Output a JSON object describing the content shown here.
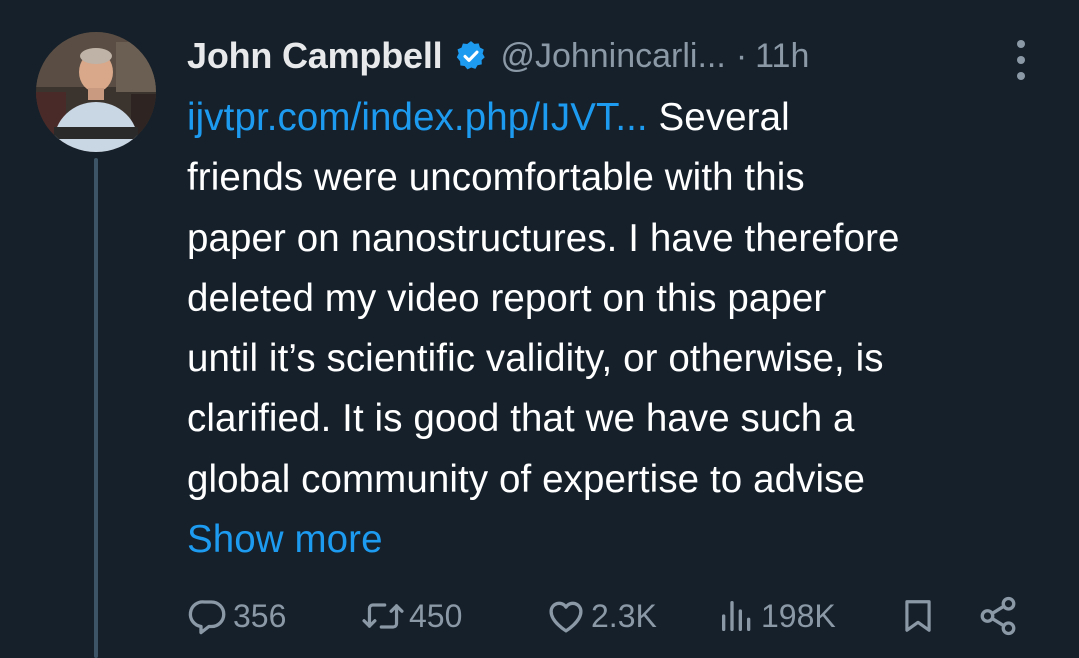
{
  "author": {
    "name": "John Campbell",
    "handle": "@Johnincarli...",
    "separator": "·",
    "time": "11h"
  },
  "tweet": {
    "link_text": "ijvtpr.com/index.php/IJVT...",
    "lines": [
      " Several",
      "friends were uncomfortable with this",
      "paper on nanostructures. I have therefore",
      "deleted my video report on this paper",
      "until it’s scientific validity, or otherwise, is",
      "clarified. It is good that we have such a",
      "global community of expertise to advise"
    ],
    "show_more": "Show more"
  },
  "actions": {
    "replies": "356",
    "retweets": "450",
    "likes": "2.3K",
    "views": "198K"
  },
  "icons": {
    "verified": "verified-badge-icon",
    "more": "more-vertical-icon",
    "reply": "reply-icon",
    "retweet": "retweet-icon",
    "like": "heart-icon",
    "views": "views-bar-chart-icon",
    "bookmark": "bookmark-icon",
    "share": "share-icon"
  },
  "colors": {
    "background": "#15202b",
    "link": "#1d9bf0",
    "muted": "#8b98a5",
    "text": "#ffffff"
  }
}
